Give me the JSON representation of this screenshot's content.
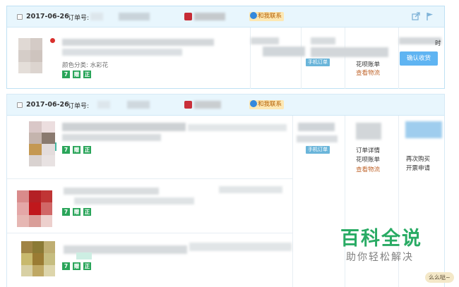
{
  "orders": [
    {
      "date": "2017-06-26",
      "order_no_label": "订单号:",
      "contact_label": "和我联系",
      "item": {
        "spec": "颜色分类: 水彩花",
        "badges": [
          "7",
          "赠",
          "正"
        ]
      },
      "phone_order_label": "手机订单",
      "status_links": [
        "花呗账单",
        "查看物流"
      ],
      "confirm_button": "确认收货",
      "colors": {
        "shop_icon": "#c62c36"
      }
    },
    {
      "date": "2017-06-26",
      "order_no_label": "订单号:",
      "contact_label": "和我联系",
      "items": [
        {
          "badges": [
            "7",
            "赠",
            "正"
          ]
        },
        {
          "badges": [
            "7",
            "赠",
            "正"
          ]
        },
        {
          "badges": [
            "7",
            "赠",
            "正"
          ]
        }
      ],
      "phone_order_label": "手机订单",
      "status_links": [
        "订单详情",
        "花呗账单",
        "查看物流"
      ],
      "action_links": [
        "再次购买",
        "开票申请"
      ],
      "colors": {
        "shop_icon": "#c9303a"
      }
    }
  ],
  "watermark": {
    "title": "百科全说",
    "subtitle": "助你轻松解决",
    "corner_tag": "么么哒~"
  },
  "colors": {
    "header_bg": "#e8f6fd",
    "badge_green": "#2aa55a",
    "contact_bg": "#fde8b4",
    "link_orange": "#c0662d",
    "button_blue": "#5fb4f2",
    "watermark_green": "#29ab64"
  }
}
